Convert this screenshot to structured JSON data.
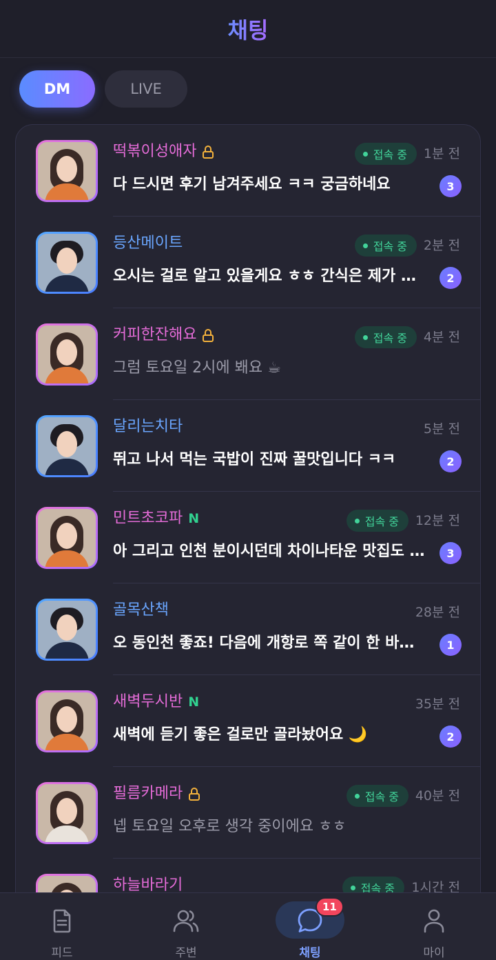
{
  "header": {
    "title": "채팅"
  },
  "tabs": {
    "dm": "DM",
    "live": "LIVE"
  },
  "colors": {
    "pink_name": "#e56cd8",
    "blue_name": "#6aa6ff",
    "online_green": "#42d49a",
    "lock_orange": "#f4b23c",
    "badge_red": "#f2455d"
  },
  "chats": [
    {
      "name": "떡볶이성애자",
      "gender": "female",
      "lock": true,
      "new": false,
      "online": true,
      "online_label": "접속 중",
      "time": "1분 전",
      "message": "다 드시면 후기 남겨주세요 ㅋㅋ 궁금하네요",
      "unread": "3"
    },
    {
      "name": "등산메이트",
      "gender": "male",
      "lock": false,
      "new": false,
      "online": true,
      "online_label": "접속 중",
      "time": "2분 전",
      "message": "오시는 걸로 알고 있을게요 ㅎㅎ 간식은 제가 챙겨갈게요",
      "unread": "2"
    },
    {
      "name": "커피한잔해요",
      "gender": "female",
      "lock": true,
      "new": false,
      "online": true,
      "online_label": "접속 중",
      "time": "4분 전",
      "message": "그럼 토요일 2시에 봬요 ☕",
      "unread": ""
    },
    {
      "name": "달리는치타",
      "gender": "male",
      "lock": false,
      "new": false,
      "online": false,
      "online_label": "",
      "time": "5분 전",
      "message": "뛰고 나서 먹는 국밥이 진짜 꿀맛입니다 ㅋㅋ",
      "unread": "2"
    },
    {
      "name": "민트초코파",
      "gender": "female",
      "lock": false,
      "new": true,
      "new_label": "N",
      "online": true,
      "online_label": "접속 중",
      "time": "12분 전",
      "message": "아 그리고 인천 분이시던데 차이나타운 맛집도 아세요?",
      "unread": "3"
    },
    {
      "name": "골목산책",
      "gender": "male",
      "lock": false,
      "new": false,
      "online": false,
      "online_label": "",
      "time": "28분 전",
      "message": "오 동인천 좋죠! 다음에 개항로 쪽 같이 한 바퀴 돌아요",
      "unread": "1"
    },
    {
      "name": "새벽두시반",
      "gender": "female",
      "lock": false,
      "new": true,
      "new_label": "N",
      "online": false,
      "online_label": "",
      "time": "35분 전",
      "message": "새벽에 듣기 좋은 걸로만 골라놨어요 🌙",
      "unread": "2"
    },
    {
      "name": "필름카메라",
      "gender": "female",
      "lock": true,
      "new": false,
      "online": true,
      "online_label": "접속 중",
      "time": "40분 전",
      "message": "넵 토요일 오후로 생각 중이에요 ㅎㅎ",
      "unread": ""
    },
    {
      "name": "하늘바라기",
      "gender": "female",
      "lock": false,
      "new": false,
      "online": true,
      "online_label": "접속 중",
      "time": "1시간 전",
      "message": "",
      "unread": ""
    }
  ],
  "bottom_nav": [
    {
      "label": "피드",
      "icon": "document-icon",
      "active": false
    },
    {
      "label": "주변",
      "icon": "people-icon",
      "active": false
    },
    {
      "label": "채팅",
      "icon": "chat-bubble-icon",
      "active": true,
      "badge": "11"
    },
    {
      "label": "마이",
      "icon": "person-icon",
      "active": false
    }
  ]
}
